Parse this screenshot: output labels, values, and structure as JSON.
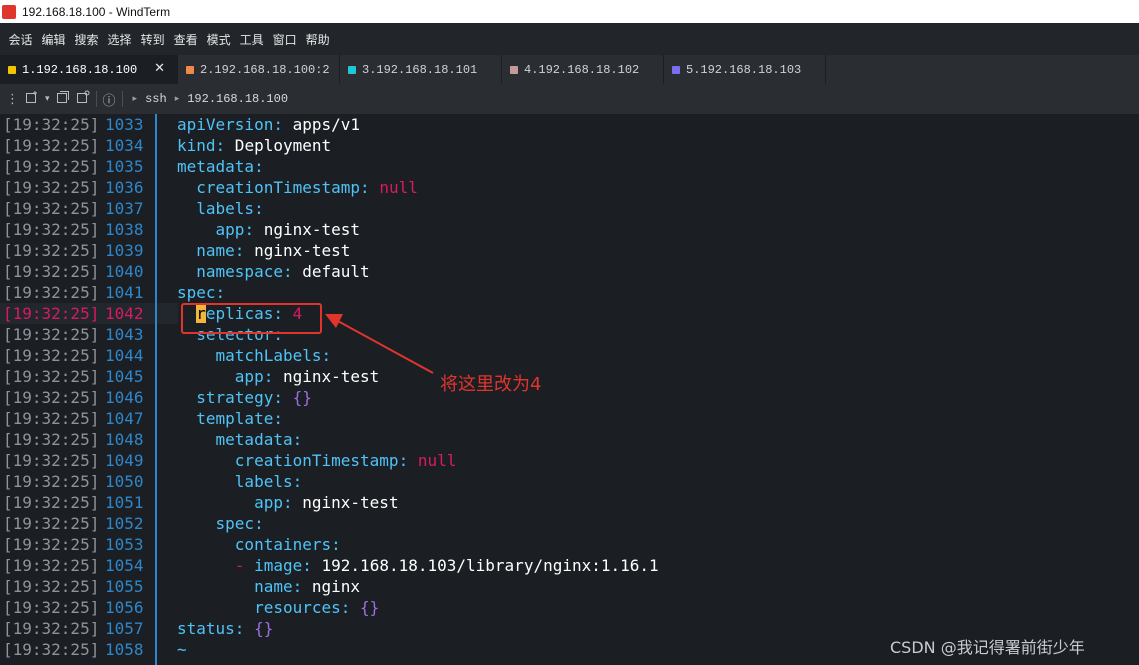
{
  "window": {
    "title": "192.168.18.100 - WindTerm"
  },
  "menu": [
    "会话",
    "编辑",
    "搜索",
    "选择",
    "转到",
    "查看",
    "模式",
    "工具",
    "窗口",
    "帮助"
  ],
  "tabs": [
    {
      "label": "1.192.168.18.100",
      "color": "#f5c400",
      "active": true,
      "close": "✕"
    },
    {
      "label": "2.192.168.18.100:2",
      "color": "#f08a4b",
      "active": false
    },
    {
      "label": "3.192.168.18.101",
      "color": "#1ec8d6",
      "active": false
    },
    {
      "label": "4.192.168.18.102",
      "color": "#c79a9a",
      "active": false
    },
    {
      "label": "5.192.168.18.103",
      "color": "#7a6ff0",
      "active": false
    }
  ],
  "toolbar": {
    "info": "ⓘ",
    "crumbs": [
      "ssh",
      "192.168.18.100"
    ]
  },
  "terminal": {
    "timestamp": "[19:32:25]",
    "lines": [
      {
        "n": "1033",
        "text": "apiVersion: apps/v1"
      },
      {
        "n": "1034",
        "text": "kind: Deployment"
      },
      {
        "n": "1035",
        "text": "metadata:"
      },
      {
        "n": "1036",
        "text": "  creationTimestamp: null"
      },
      {
        "n": "1037",
        "text": "  labels:"
      },
      {
        "n": "1038",
        "text": "    app: nginx-test"
      },
      {
        "n": "1039",
        "text": "  name: nginx-test"
      },
      {
        "n": "1040",
        "text": "  namespace: default"
      },
      {
        "n": "1041",
        "text": "spec:"
      },
      {
        "n": "1042",
        "text": "  replicas: 4",
        "highlight": true
      },
      {
        "n": "1043",
        "text": "  selector:"
      },
      {
        "n": "1044",
        "text": "    matchLabels:"
      },
      {
        "n": "1045",
        "text": "      app: nginx-test"
      },
      {
        "n": "1046",
        "text": "  strategy: {}"
      },
      {
        "n": "1047",
        "text": "  template:"
      },
      {
        "n": "1048",
        "text": "    metadata:"
      },
      {
        "n": "1049",
        "text": "      creationTimestamp: null"
      },
      {
        "n": "1050",
        "text": "      labels:"
      },
      {
        "n": "1051",
        "text": "        app: nginx-test"
      },
      {
        "n": "1052",
        "text": "    spec:"
      },
      {
        "n": "1053",
        "text": "      containers:"
      },
      {
        "n": "1054",
        "text": "      - image: 192.168.18.103/library/nginx:1.16.1"
      },
      {
        "n": "1055",
        "text": "        name: nginx"
      },
      {
        "n": "1056",
        "text": "        resources: {}"
      },
      {
        "n": "1057",
        "text": "status: {}"
      },
      {
        "n": "1058",
        "text": "~"
      }
    ]
  },
  "annotation": {
    "text": "将这里改为4",
    "color": "#e0352b"
  },
  "watermark": "CSDN @我记得署前街少年"
}
